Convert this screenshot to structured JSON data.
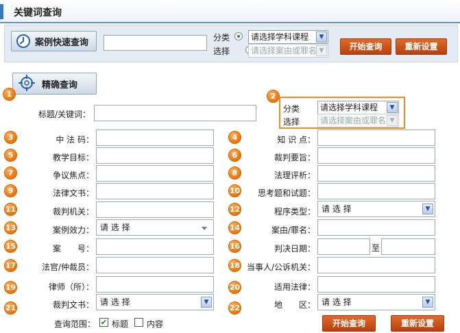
{
  "header": {
    "title": "关键词查询"
  },
  "quick": {
    "button_label": "案例快速查询",
    "classify_label": "分类",
    "select_label": "选择",
    "course_value": "请选择学科课程",
    "reason_value": "请选择案由或罪名",
    "search_label": "开始查询",
    "reset_label": "重新设置"
  },
  "precise": {
    "button_label": "精确查询",
    "keyword_label": "标题/关键词：",
    "classify_label": "分类",
    "select_label": "选择",
    "course_value": "请选择学科课程",
    "reason_value": "请选择案由或罪名",
    "please_select": "请 选 择",
    "date_to": "至",
    "scope_label": "查询范围：",
    "scope_title": "标题",
    "scope_content": "内容",
    "search_label": "开始查询",
    "reset_label": "重新设置"
  },
  "numbers": [
    "1",
    "2",
    "3",
    "4",
    "5",
    "6",
    "7",
    "8",
    "9",
    "10",
    "11",
    "12",
    "13",
    "14",
    "15",
    "16",
    "17",
    "18",
    "19",
    "20",
    "21",
    "22"
  ],
  "labels": {
    "l3": "中 法 码：",
    "l4": "知 识 点：",
    "l5": "教学目标：",
    "l6": "裁判要旨：",
    "l7": "争议焦点：",
    "l8": "法理评析：",
    "l9": "法律文书：",
    "l10": "思考题和试题：",
    "l11": "裁判机关：",
    "l12": "程序类型：",
    "l13": "案例效力：",
    "l14": "案由/罪名：",
    "l15": "案　　号：",
    "l16": "判决日期：",
    "l17": "法官/仲裁员：",
    "l18": "当事人/公诉机关：",
    "l19": "律师（所）：",
    "l20": "适用法律：",
    "l21": "裁判文书：",
    "l22": "地　　区："
  }
}
